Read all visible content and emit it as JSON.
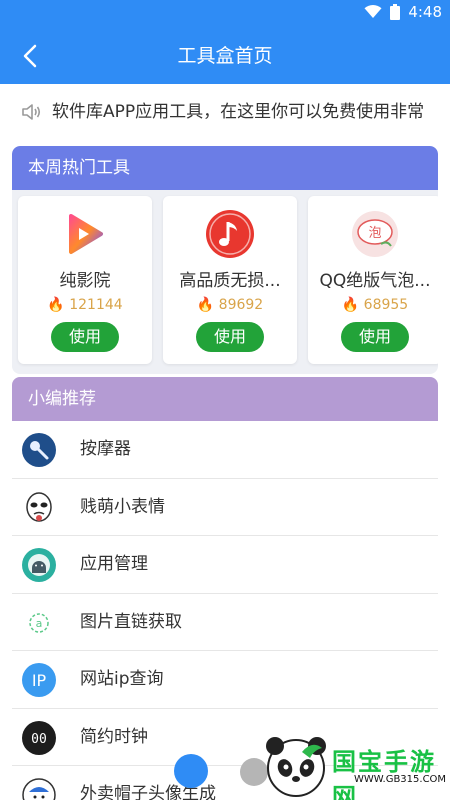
{
  "status": {
    "time": "4:48"
  },
  "appbar": {
    "title": "工具盒首页",
    "back_icon": "back-arrow-icon"
  },
  "notice": {
    "text": "软件库APP应用工具，在这里你可以免费使用非常"
  },
  "hot": {
    "header": "本周热门工具",
    "header_color": "#6b7de6",
    "tools": [
      {
        "name": "纯影院",
        "count": "121144",
        "button": "使用",
        "icon": "video-play-icon"
      },
      {
        "name": "高品质无损...",
        "count": "89692",
        "button": "使用",
        "icon": "music-note-icon"
      },
      {
        "name": "QQ绝版气泡...",
        "count": "68955",
        "button": "使用",
        "icon": "bubble-icon"
      }
    ]
  },
  "recommend": {
    "header": "小编推荐",
    "header_color": "#b49bd3",
    "items": [
      {
        "label": "按摩器",
        "icon": "massager-icon"
      },
      {
        "label": "贱萌小表情",
        "icon": "meme-face-icon"
      },
      {
        "label": "应用管理",
        "icon": "android-icon"
      },
      {
        "label": "图片直链获取",
        "icon": "link-icon"
      },
      {
        "label": "网站ip查询",
        "icon": "ip-icon"
      },
      {
        "label": "简约时钟",
        "icon": "clock-icon"
      },
      {
        "label": "外卖帽子头像生成",
        "icon": "avatar-hat-icon"
      }
    ]
  },
  "watermark": {
    "text": "国宝手游网",
    "url": "WWW.GB315.COM"
  },
  "colors": {
    "primary": "#2f8cf5",
    "button_green": "#22a339",
    "count_gold": "#d9a44a"
  }
}
